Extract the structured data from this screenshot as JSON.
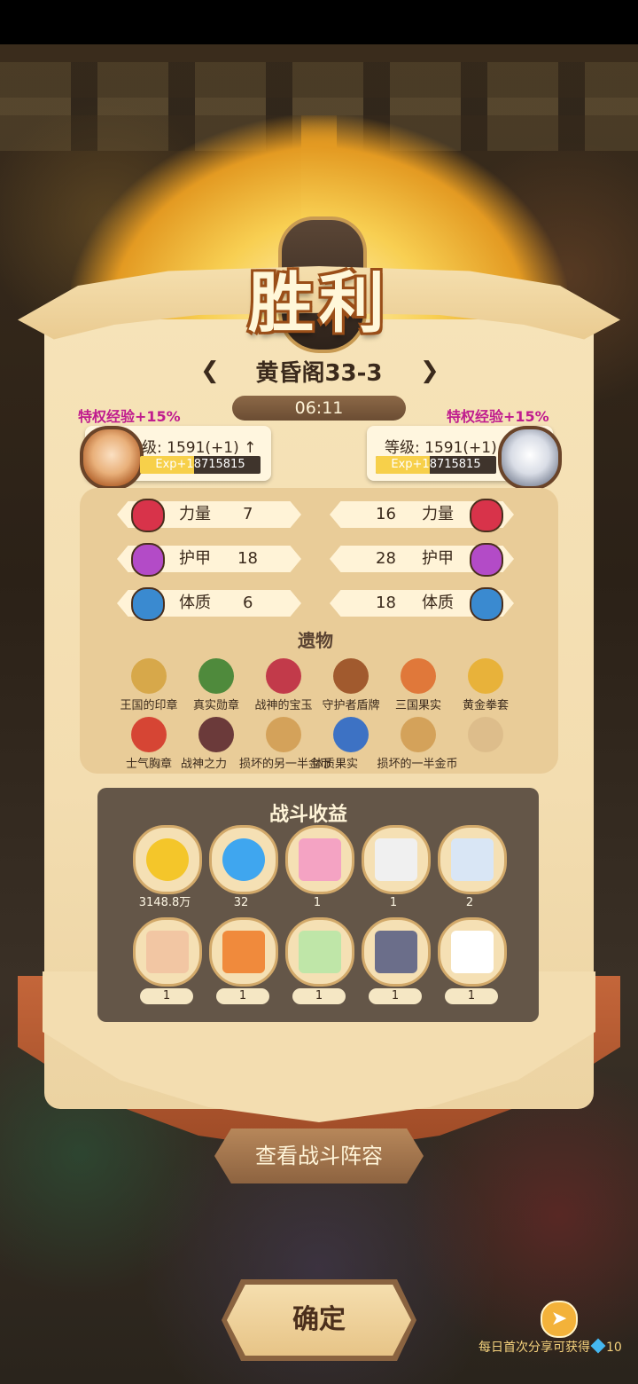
{
  "header": {
    "title": "胜利"
  },
  "stage": {
    "name": "黄昏阁33-3",
    "time": "06:11"
  },
  "players": {
    "left": {
      "bonus": "特权经验+15%",
      "level": "级: 1591(+1)",
      "level_arrow": "↑",
      "exp": "Exp+18715815",
      "exp_fraction": 0.45
    },
    "right": {
      "bonus": "特权经验+15%",
      "level": "等级: 1591(+1)",
      "exp": "Exp+18715815",
      "exp_fraction": 0.45
    }
  },
  "stats": {
    "left": [
      {
        "name": "力量",
        "value": "7",
        "color": "#d8334a"
      },
      {
        "name": "护甲",
        "value": "18",
        "color": "#b34bc7"
      },
      {
        "name": "体质",
        "value": "6",
        "color": "#3a8ad0"
      }
    ],
    "right": [
      {
        "name": "力量",
        "value": "16",
        "color": "#d8334a"
      },
      {
        "name": "护甲",
        "value": "28",
        "color": "#b34bc7"
      },
      {
        "name": "体质",
        "value": "18",
        "color": "#3a8ad0"
      }
    ]
  },
  "relics": {
    "title": "遗物",
    "items": [
      {
        "label": "王国的印章",
        "icon": "seal-icon"
      },
      {
        "label": "真实勋章",
        "icon": "medal-icon"
      },
      {
        "label": "战神的宝玉",
        "icon": "jade-icon"
      },
      {
        "label": "守护者盾牌",
        "icon": "shield-icon"
      },
      {
        "label": "三国果实",
        "icon": "fruit-icon"
      },
      {
        "label": "黄金拳套",
        "icon": "gauntlet-icon"
      },
      {
        "label": "士气胸章",
        "icon": "badge-icon"
      },
      {
        "label": "战神之力",
        "icon": "bowl-icon"
      },
      {
        "label": "损坏的另一半金币",
        "icon": "coin-half-icon"
      },
      {
        "label": "体质果实",
        "icon": "blueberry-icon"
      },
      {
        "label": "损坏的一半金币",
        "icon": "coin-half-2-icon"
      }
    ]
  },
  "rewards": {
    "title": "战斗收益",
    "items": [
      {
        "count": "3148.8万",
        "icon": "gold-gem-icon",
        "color": "#f4c62a"
      },
      {
        "count": "32",
        "icon": "diamond-icon",
        "color": "#3fa6ef"
      },
      {
        "count": "1",
        "icon": "pink-pig-card-icon",
        "color": "#f4a3c3"
      },
      {
        "count": "1",
        "icon": "white-beast-card-icon",
        "color": "#f0f0f0"
      },
      {
        "count": "2",
        "icon": "ice-warrior-card-icon",
        "color": "#d9e6f5"
      },
      {
        "count": "1",
        "icon": "dwarf-card-icon",
        "color": "#f2c6a3"
      },
      {
        "count": "1",
        "icon": "fire-dragon-card-icon",
        "color": "#f08a3c"
      },
      {
        "count": "1",
        "icon": "leaf-spirit-card-icon",
        "color": "#bfe6a8"
      },
      {
        "count": "1",
        "icon": "mole-card-icon",
        "color": "#6b6e8a"
      },
      {
        "count": "1",
        "icon": "white-cube-card-icon",
        "color": "#ffffff"
      }
    ]
  },
  "buttons": {
    "view_team": "查看战斗阵容",
    "confirm": "确定"
  },
  "share": {
    "text": "每日首次分享可获得",
    "amount": "10"
  }
}
